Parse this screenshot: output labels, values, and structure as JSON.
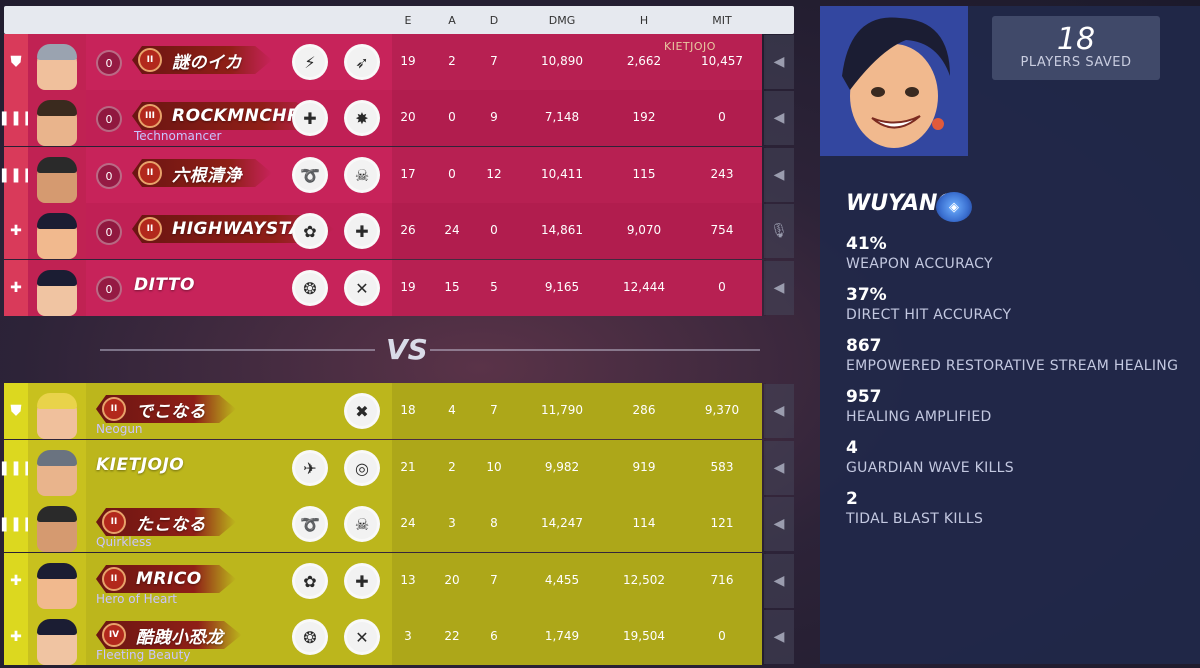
{
  "columns": [
    "E",
    "A",
    "D",
    "DMG",
    "H",
    "MIT"
  ],
  "overlay_name": "KIETJOJO",
  "team_red": [
    {
      "role_icon": "shield-icon",
      "role_glyph": "⛊",
      "level": "0",
      "rank": "II",
      "name": "謎のイカ",
      "title": "",
      "perk1": "⚡",
      "perk2": "➶",
      "e": "19",
      "a": "2",
      "d": "7",
      "dmg": "10,890",
      "h": "2,662",
      "mit": "10,457",
      "mic": "speaker-icon"
    },
    {
      "role_icon": "damage-icon",
      "role_glyph": "❚❚❚",
      "level": "0",
      "rank": "III",
      "name": "ROCKMNCHR",
      "title": "Technomancer",
      "perk1": "✚",
      "perk2": "✸",
      "e": "20",
      "a": "0",
      "d": "9",
      "dmg": "7,148",
      "h": "192",
      "mit": "0",
      "mic": "speaker-icon"
    },
    {
      "role_icon": "damage-icon",
      "role_glyph": "❚❚❚",
      "level": "0",
      "rank": "II",
      "name": "六根清浄",
      "title": "",
      "perk1": "➰",
      "perk2": "☠",
      "e": "17",
      "a": "0",
      "d": "12",
      "dmg": "10,411",
      "h": "115",
      "mit": "243",
      "mic": "speaker-icon"
    },
    {
      "role_icon": "support-icon",
      "role_glyph": "✚",
      "level": "0",
      "rank": "II",
      "name": "HIGHWAYSTAR",
      "title": "",
      "perk1": "✿",
      "perk2": "✚",
      "e": "26",
      "a": "24",
      "d": "0",
      "dmg": "14,861",
      "h": "9,070",
      "mit": "754",
      "mic": "mic-icon"
    },
    {
      "role_icon": "support-icon",
      "role_glyph": "✚",
      "level": "0",
      "rank": "",
      "name": "DITTO",
      "title": "",
      "perk1": "❂",
      "perk2": "✕",
      "e": "19",
      "a": "15",
      "d": "5",
      "dmg": "9,165",
      "h": "12,444",
      "mit": "0",
      "mic": "speaker-icon"
    }
  ],
  "vs_label": "VS",
  "team_yellow": [
    {
      "role_icon": "shield-icon",
      "role_glyph": "⛊",
      "level": "",
      "rank": "II",
      "name": "でこなる",
      "title": "Neogun",
      "perk1": "",
      "perk2": "✖",
      "e": "18",
      "a": "4",
      "d": "7",
      "dmg": "11,790",
      "h": "286",
      "mit": "9,370",
      "mic": "speaker-icon"
    },
    {
      "role_icon": "damage-icon",
      "role_glyph": "❚❚❚",
      "level": "",
      "rank": "",
      "name": "KIETJOJO",
      "title": "",
      "perk1": "✈",
      "perk2": "◎",
      "e": "21",
      "a": "2",
      "d": "10",
      "dmg": "9,982",
      "h": "919",
      "mit": "583",
      "mic": "speaker-icon"
    },
    {
      "role_icon": "damage-icon",
      "role_glyph": "❚❚❚",
      "level": "",
      "rank": "II",
      "name": "たこなる",
      "title": "Quirkless",
      "perk1": "➰",
      "perk2": "☠",
      "e": "24",
      "a": "3",
      "d": "8",
      "dmg": "14,247",
      "h": "114",
      "mit": "121",
      "mic": "speaker-icon"
    },
    {
      "role_icon": "support-icon",
      "role_glyph": "✚",
      "level": "",
      "rank": "II",
      "name": "MRICO",
      "title": "Hero of Heart",
      "perk1": "✿",
      "perk2": "✚",
      "e": "13",
      "a": "20",
      "d": "7",
      "dmg": "4,455",
      "h": "12,502",
      "mit": "716",
      "mic": "speaker-icon"
    },
    {
      "role_icon": "support-icon",
      "role_glyph": "✚",
      "level": "",
      "rank": "IV",
      "name": "酷跩小恐龙",
      "title": "Fleeting Beauty",
      "perk1": "❂",
      "perk2": "✕",
      "e": "3",
      "a": "22",
      "d": "6",
      "dmg": "1,749",
      "h": "19,504",
      "mit": "0",
      "mic": "speaker-icon"
    }
  ],
  "panel": {
    "players_saved_value": "18",
    "players_saved_label": "PLAYERS SAVED",
    "hero_name": "WUYANG",
    "stats": [
      {
        "value": "41%",
        "label": "WEAPON ACCURACY"
      },
      {
        "value": "37%",
        "label": "DIRECT HIT ACCURACY"
      },
      {
        "value": "867",
        "label": "EMPOWERED RESTORATIVE STREAM HEALING"
      },
      {
        "value": "957",
        "label": "HEALING AMPLIFIED"
      },
      {
        "value": "4",
        "label": "GUARDIAN WAVE KILLS"
      },
      {
        "value": "2",
        "label": "TIDAL BLAST KILLS"
      }
    ]
  },
  "colors": {
    "red_team": "#c7235a",
    "yellow_team": "#bcb61c",
    "panel": "#21284a"
  }
}
